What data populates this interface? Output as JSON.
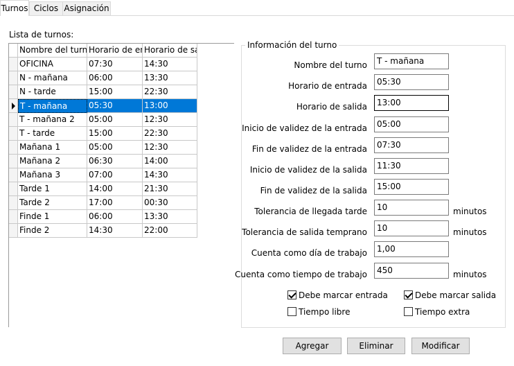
{
  "tabs": [
    {
      "label": "Turnos"
    },
    {
      "label": "Ciclos"
    },
    {
      "label": "Asignación"
    }
  ],
  "list": {
    "label": "Lista de turnos:",
    "columns": [
      "Nombre del turno",
      "Horario de ent",
      "Horario de sal"
    ],
    "rows": [
      [
        "OFICINA",
        "07:30",
        "14:30"
      ],
      [
        "N - mañana",
        "06:00",
        "13:30"
      ],
      [
        "N - tarde",
        "15:00",
        "22:30"
      ],
      [
        "T - mañana",
        "05:30",
        "13:00"
      ],
      [
        "T - mañana 2",
        "05:00",
        "12:30"
      ],
      [
        "T - tarde",
        "15:00",
        "22:30"
      ],
      [
        "Mañana 1",
        "05:00",
        "12:30"
      ],
      [
        "Mañana 2",
        "06:30",
        "14:00"
      ],
      [
        "Mañana 3",
        "07:00",
        "14:30"
      ],
      [
        "Tarde 1",
        "14:00",
        "21:30"
      ],
      [
        "Tarde 2",
        "17:00",
        "00:30"
      ],
      [
        "Finde 1",
        "06:00",
        "13:30"
      ],
      [
        "Finde 2",
        "14:30",
        "22:00"
      ]
    ],
    "selected_index": 3
  },
  "info": {
    "title": "Información del turno",
    "fields": [
      {
        "label": "Nombre del turno",
        "value": "T - mañana"
      },
      {
        "label": "Horario de entrada",
        "value": "05:30"
      },
      {
        "label": "Horario de salida",
        "value": "13:00"
      },
      {
        "label": "Inicio de validez de la entrada",
        "value": "05:00"
      },
      {
        "label": "Fin de validez de la entrada",
        "value": "07:30"
      },
      {
        "label": "Inicio de validez de la salida",
        "value": "11:30"
      },
      {
        "label": "Fin de validez de la salida",
        "value": "15:00"
      },
      {
        "label": "Tolerancia de llegada tarde",
        "value": "10",
        "unit": "minutos"
      },
      {
        "label": "Tolerancia de salida temprano",
        "value": "10",
        "unit": "minutos"
      },
      {
        "label": "Cuenta como día de trabajo",
        "value": "1,00"
      },
      {
        "label": "Cuenta como tiempo de trabajo",
        "value": "450",
        "unit": "minutos"
      }
    ],
    "checkboxes": [
      {
        "label": "Debe marcar entrada",
        "checked": true
      },
      {
        "label": "Debe marcar salida",
        "checked": true
      },
      {
        "label": "Tiempo libre",
        "checked": false
      },
      {
        "label": "Tiempo extra",
        "checked": false
      }
    ]
  },
  "buttons": {
    "add": "Agregar",
    "delete": "Eliminar",
    "modify": "Modificar"
  }
}
